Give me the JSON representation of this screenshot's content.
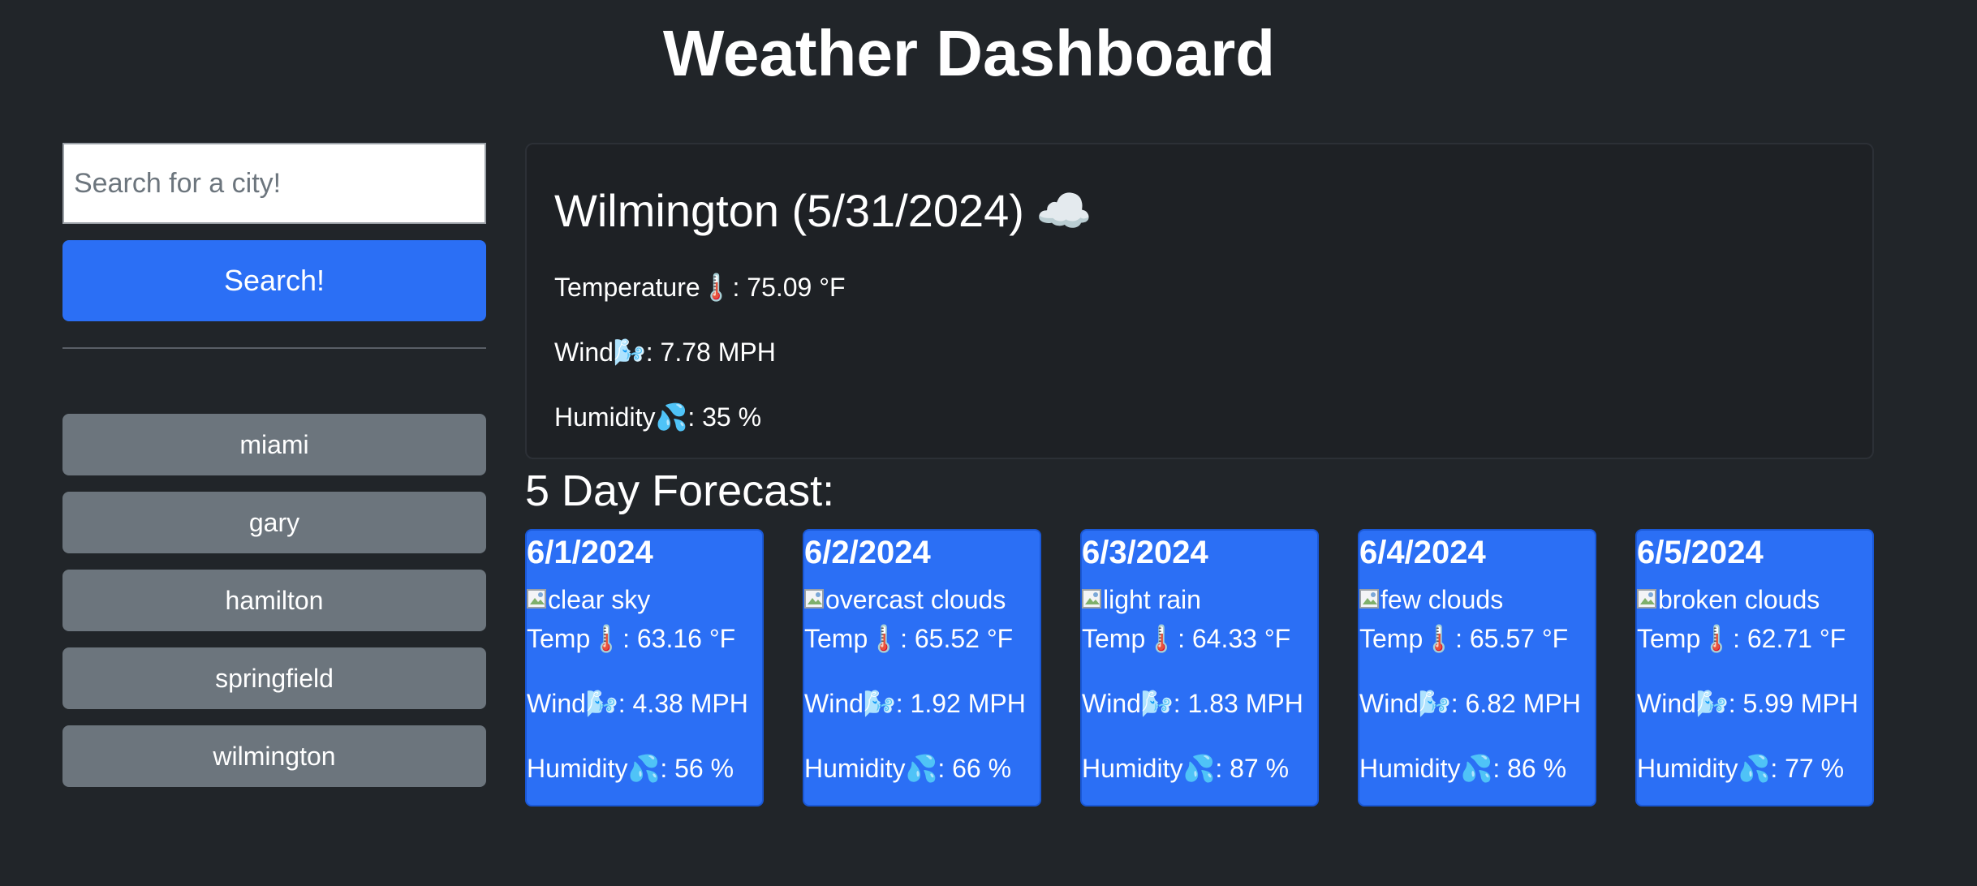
{
  "header": {
    "title": "Weather Dashboard"
  },
  "search": {
    "placeholder": "Search for a city!",
    "button_label": "Search!"
  },
  "history": [
    {
      "label": "miami"
    },
    {
      "label": "gary"
    },
    {
      "label": "hamilton"
    },
    {
      "label": "springfield"
    },
    {
      "label": "wilmington"
    }
  ],
  "current": {
    "heading": "Wilmington (5/31/2024)",
    "weather_icon": "☁️",
    "temperature": "Temperature🌡️: 75.09 °F",
    "wind": "Wind🌬️: 7.78 MPH",
    "humidity": "Humidity💦: 35 %"
  },
  "forecast": {
    "title": "5 Day Forecast:",
    "days": [
      {
        "date": "6/1/2024",
        "description": "clear sky",
        "temp": "Temp🌡️: 63.16 °F",
        "wind": "Wind🌬️: 4.38 MPH",
        "humidity": "Humidity💦: 56 %"
      },
      {
        "date": "6/2/2024",
        "description": "overcast clouds",
        "temp": "Temp🌡️: 65.52 °F",
        "wind": "Wind🌬️: 1.92 MPH",
        "humidity": "Humidity💦: 66 %"
      },
      {
        "date": "6/3/2024",
        "description": "light rain",
        "temp": "Temp🌡️: 64.33 °F",
        "wind": "Wind🌬️: 1.83 MPH",
        "humidity": "Humidity💦: 87 %"
      },
      {
        "date": "6/4/2024",
        "description": "few clouds",
        "temp": "Temp🌡️: 65.57 °F",
        "wind": "Wind🌬️: 6.82 MPH",
        "humidity": "Humidity💦: 86 %"
      },
      {
        "date": "6/5/2024",
        "description": "broken clouds",
        "temp": "Temp🌡️: 62.71 °F",
        "wind": "Wind🌬️: 5.99 MPH",
        "humidity": "Humidity💦: 77 %"
      }
    ]
  },
  "colors": {
    "background": "#212529",
    "primary": "#2b6ff5",
    "secondary": "#6c757d"
  }
}
